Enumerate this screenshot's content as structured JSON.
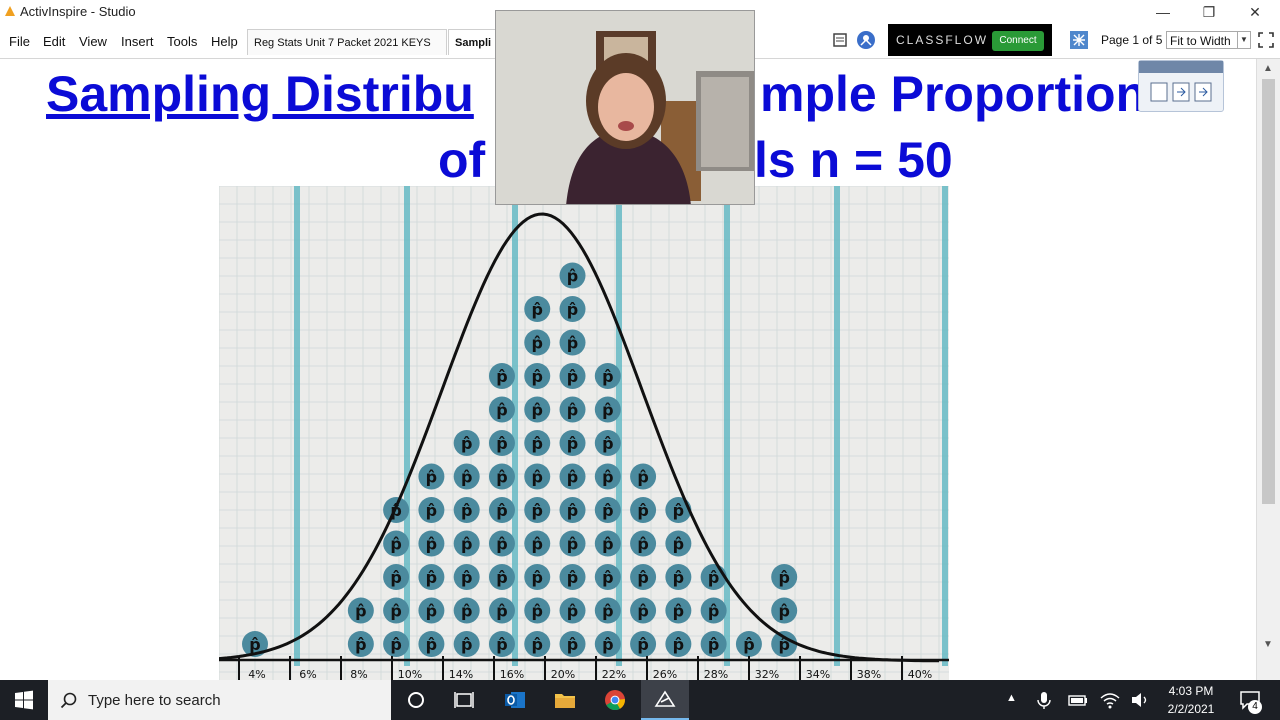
{
  "window": {
    "title": "ActivInspire - Studio",
    "minimize": "—",
    "restore": "❐",
    "close": "✕"
  },
  "menu": [
    "File",
    "Edit",
    "View",
    "Insert",
    "Tools",
    "Help"
  ],
  "tabs": [
    {
      "label": "Reg Stats Unit 7 Packet 2021 KEYS"
    },
    {
      "label": "Sampli"
    }
  ],
  "classflow": {
    "brand": "CLASSFLOW",
    "connect": "Connect"
  },
  "page_info": "Page 1 of 5",
  "zoom": {
    "value": "Fit to Width"
  },
  "slide": {
    "title_line1_a": "Sampling Distribu",
    "title_line1_b": "mple Proportions",
    "title_line2_a": "of",
    "title_line2_b": "ls n = 50"
  },
  "board": {
    "dot_symbol": "p̂",
    "dot_columns": [
      1,
      0,
      0,
      2,
      5,
      6,
      7,
      9,
      11,
      12,
      9,
      6,
      5,
      3,
      1,
      3,
      0,
      0
    ],
    "axis_labels": [
      "4%",
      "6%",
      "8%",
      "10%",
      "14%",
      "16%",
      "20%",
      "22%",
      "26%",
      "28%",
      "32%",
      "34%",
      "38%",
      "40%"
    ],
    "colors": {
      "paper": "#ececea",
      "grid": "#cfd8d8",
      "stripe": "#5eb6c2",
      "dot": "#4b8a9e",
      "curve": "#111111"
    }
  },
  "taskbar": {
    "search_placeholder": "Type here to search",
    "time": "4:03 PM",
    "date": "2/2/2021",
    "notifications": "4",
    "icons": [
      "windows-start-icon",
      "cortana-icon",
      "task-view-icon",
      "outlook-icon",
      "file-explorer-icon",
      "chrome-icon",
      "activinspire-icon"
    ]
  }
}
